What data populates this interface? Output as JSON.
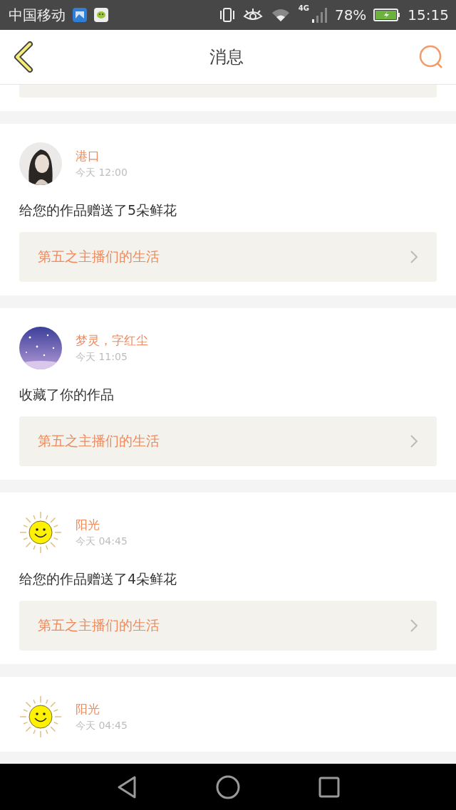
{
  "status_bar": {
    "carrier": "中国移动",
    "network": "4G",
    "battery": "78%",
    "time": "15:15"
  },
  "header": {
    "title": "消息"
  },
  "messages": [
    {
      "kind": "portrait",
      "name": "港口",
      "time": "今天 12:00",
      "text": "给您的作品赠送了5朵鲜花",
      "link": "第五之主播们的生活"
    },
    {
      "kind": "starry",
      "name": "梦灵，字红尘",
      "time": "今天 11:05",
      "text": "收藏了你的作品",
      "link": "第五之主播们的生活"
    },
    {
      "kind": "sun",
      "name": "阳光",
      "time": "今天 04:45",
      "text": "给您的作品赠送了4朵鲜花",
      "link": "第五之主播们的生活"
    },
    {
      "kind": "sun",
      "name": "阳光",
      "time": "今天 04:45"
    }
  ]
}
